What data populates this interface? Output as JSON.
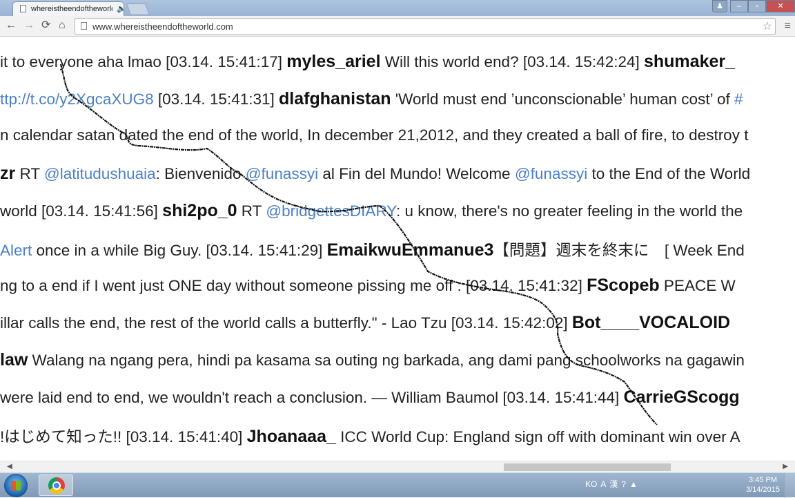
{
  "browser": {
    "tab_title": "whereistheendoftheworld.com",
    "tab_close": "✕",
    "speaker": "🔈",
    "url": "www.whereistheendoftheworld.com",
    "back": "←",
    "forward": "→",
    "reload": "⟳",
    "home": "⌂",
    "star": "☆",
    "menu": "≡",
    "window_min": "–",
    "window_max": "▫",
    "window_close": "✕",
    "account": "♟"
  },
  "feed": {
    "lines": [
      [
        {
          "t": "it to everyone aha lmao [03.14. 15:41:17] "
        },
        {
          "t": "myles_ariel",
          "k": "u"
        },
        {
          "t": " Will this world end? [03.14. 15:42:24] "
        },
        {
          "t": "shumaker_",
          "k": "u"
        }
      ],
      [
        {
          "t": "ttp://t.co/y2XgcaXUG8",
          "k": "lk"
        },
        {
          "t": " [03.14. 15:41:31] "
        },
        {
          "t": "dlafghanistan",
          "k": "u"
        },
        {
          "t": " 'World must end ’unconscionable’ human cost’ of "
        },
        {
          "t": "#",
          "k": "lk"
        }
      ],
      [
        {
          "t": "n calendar satan dated the end of the world, In december 21,2012, and they created a ball of fire, to destroy t"
        }
      ],
      [
        {
          "t": "zr",
          "k": "u"
        },
        {
          "t": " RT "
        },
        {
          "t": "@latitudushuaia",
          "k": "lk"
        },
        {
          "t": ": Bienvenido "
        },
        {
          "t": "@funassyi",
          "k": "lk"
        },
        {
          "t": " al Fin del Mundo! Welcome "
        },
        {
          "t": "@funassyi",
          "k": "lk"
        },
        {
          "t": " to the End of the World"
        }
      ],
      [
        {
          "t": "world [03.14. 15:41:56] "
        },
        {
          "t": "shi2po_0",
          "k": "u"
        },
        {
          "t": " RT "
        },
        {
          "t": "@bridgettesDIARY",
          "k": "lk"
        },
        {
          "t": ": u know, there's no greater feeling in the world the"
        }
      ],
      [
        {
          "t": "Alert",
          "k": "lk"
        },
        {
          "t": " once in a while Big Guy. [03.14. 15:41:29] "
        },
        {
          "t": "EmaikwuEmmanue3",
          "k": "u"
        },
        {
          "t": "【問題】週末を終末に　[ Week End"
        }
      ],
      [
        {
          "t": "ng to a end if I went just ONE day without someone pissing me off : [03.14. 15:41:32] "
        },
        {
          "t": "FScopeb",
          "k": "u"
        },
        {
          "t": " PEACE W"
        }
      ],
      [
        {
          "t": "illar calls the end, the rest of the world calls a butterfly.\" - Lao Tzu [03.14. 15:42:02] "
        },
        {
          "t": "Bot____VOCALOID",
          "k": "u"
        }
      ],
      [
        {
          "t": "law",
          "k": "u"
        },
        {
          "t": " Walang na ngang pera, hindi pa kasama sa outing ng barkada, ang dami pang schoolworks na gagawin"
        }
      ],
      [
        {
          "t": "were laid end to end, we wouldn't reach a conclusion. — William Baumol [03.14. 15:41:44] "
        },
        {
          "t": "CarrieGScogg",
          "k": "u"
        }
      ],
      [
        {
          "t": "!はじめて知った!! [03.14. 15:41:40] "
        },
        {
          "t": "Jhoanaaa_",
          "k": "u"
        },
        {
          "t": " ICC World Cup: England sign off with dominant win over A"
        }
      ]
    ]
  },
  "scrollbar": {
    "left_arrow": "◀",
    "right_arrow": "▶"
  },
  "taskbar": {
    "tray_lang": "KO",
    "tray_ime": "A",
    "tray_hanja": "漢",
    "tray_help": "?",
    "tray_up": "▲",
    "time": "3:45 PM",
    "date": "3/14/2015"
  }
}
